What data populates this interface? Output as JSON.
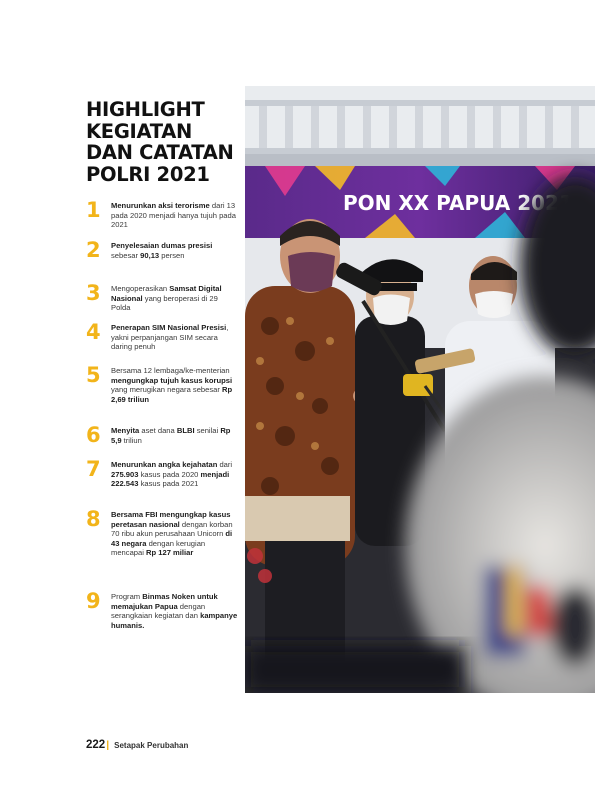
{
  "title_lines": [
    "HIGHLIGHT",
    "KEGIATAN",
    "DAN CATATAN",
    "POLRI 2021"
  ],
  "items": [
    {
      "num": "1",
      "html": "<b>Menurunkan aksi terorisme</b> dari 13 pada 2020 menjadi hanya tujuh pada 2021"
    },
    {
      "num": "2",
      "html": "<b>Penyelesaian dumas presisi</b> sebesar <b>90,13</b> persen"
    },
    {
      "num": "3",
      "html": "Mengoperasikan <b>Samsat Digital Nasional</b> yang beroperasi di 29 Polda"
    },
    {
      "num": "4",
      "html": "<b>Penerapan SIM Nasional Presisi</b>, yakni perpanjangan SIM secara daring penuh"
    },
    {
      "num": "5",
      "html": "Bersama 12 lembaga/ke-menterian <b>mengungkap tujuh kasus korupsi</b> yang merugikan negara sebesar <b>Rp 2,69 triliun</b>"
    },
    {
      "num": "6",
      "html": "<b>Menyita</b> aset dana <b>BLBI</b> senilai <b>Rp 5,9</b> triliun"
    },
    {
      "num": "7",
      "html": "<b>Menurunkan angka kejahatan</b> dari <b>275.903</b> kasus pada 2020 <b>menjadi 222.543</b> kasus pada 2021"
    },
    {
      "num": "8",
      "html": "<b>Bersama FBI mengungkap kasus peretasan nasional</b> dengan korban 70 ribu akun perusahaan Unicorn <b>di 43 negara</b> dengan kerugian mencapai <b>Rp 127 miliar</b>"
    },
    {
      "num": "9",
      "html": "Program <b>Binmas Noken untuk memajukan Papua</b> dengan serangkaian kegiatan dan <b>kampanye humanis.</b>"
    }
  ],
  "photo": {
    "banner_text": "PON XX PAPUA 2021"
  },
  "footer": {
    "page_number": "222",
    "separator": "|",
    "book_title": "Setapak Perubahan"
  }
}
